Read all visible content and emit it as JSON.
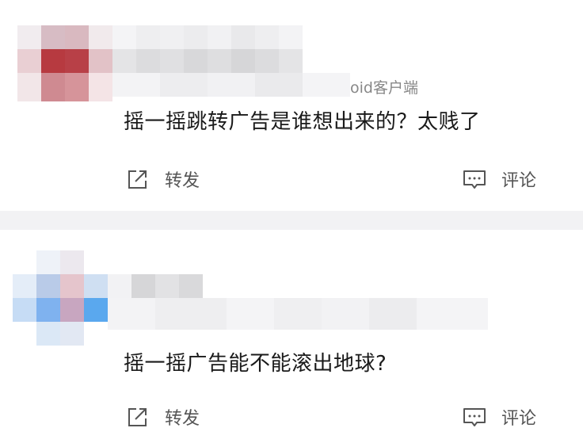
{
  "posts": [
    {
      "source_text": "oid客户端",
      "comment": "摇一摇跳转广告是谁想出来的？太贱了",
      "actions": {
        "repost": "转发",
        "comment": "评论"
      },
      "avatar_color": "#c0393d"
    },
    {
      "comment": "摇一摇广告能不能滚出地球?",
      "actions": {
        "repost": "转发",
        "comment": "评论"
      },
      "avatar_color": "#5aa8ee"
    }
  ]
}
